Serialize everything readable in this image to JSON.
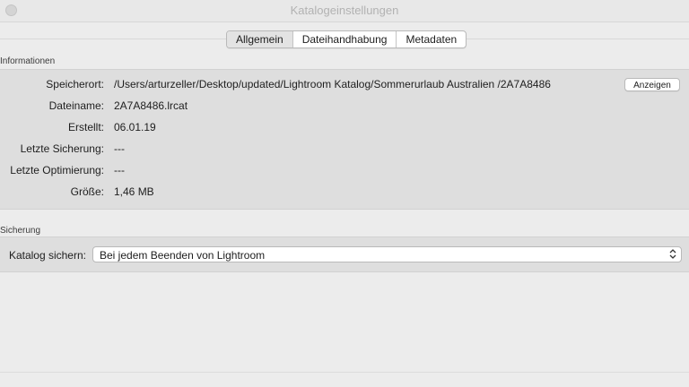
{
  "window": {
    "title": "Katalogeinstellungen"
  },
  "tabs": [
    {
      "label": "Allgemein",
      "active": true
    },
    {
      "label": "Dateihandhabung",
      "active": false
    },
    {
      "label": "Metadaten",
      "active": false
    }
  ],
  "info": {
    "section_label": "Informationen",
    "rows": [
      {
        "label": "Speicherort:",
        "value": "/Users/arturzeller/Desktop/updated/Lightroom Katalog/Sommerurlaub Australien /2A7A8486"
      },
      {
        "label": "Dateiname:",
        "value": "2A7A8486.lrcat"
      },
      {
        "label": "Erstellt:",
        "value": "06.01.19"
      },
      {
        "label": "Letzte Sicherung:",
        "value": "---"
      },
      {
        "label": "Letzte Optimierung:",
        "value": "---"
      },
      {
        "label": "Größe:",
        "value": "1,46 MB"
      }
    ],
    "show_button_label": "Anzeigen"
  },
  "backup": {
    "section_label": "Sicherung",
    "catalog_label": "Katalog sichern:",
    "catalog_value": "Bei jedem Beenden von Lightroom"
  },
  "colors": {
    "window_bg": "#ececec",
    "panel_bg": "#dedede",
    "title_text": "#b2b2b2"
  },
  "icons": {
    "window_control": "close-circle",
    "select_arrows": "updown-chevrons"
  }
}
